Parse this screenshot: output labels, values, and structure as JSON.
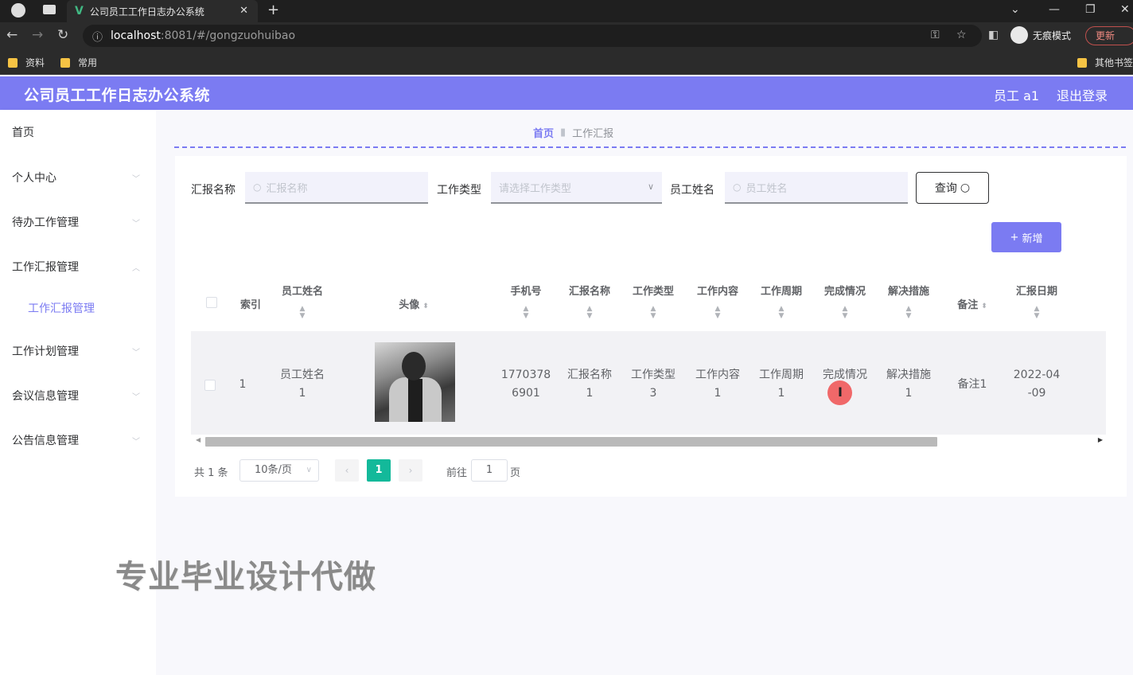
{
  "browser": {
    "tab_title": "公司员工工作日志办公系统",
    "url_host": "localhost",
    "url_path": ":8081/#/gongzuohuibao",
    "incognito_label": "无痕模式",
    "update_label": "更新",
    "bookmarks": [
      "资料",
      "常用"
    ],
    "other_bookmarks": "其他书签"
  },
  "header": {
    "title": "公司员工工作日志办公系统",
    "user": "员工 a1",
    "logout": "退出登录",
    "color": "#7b7bf2"
  },
  "sidebar": {
    "items": [
      {
        "label": "首页"
      },
      {
        "label": "个人中心"
      },
      {
        "label": "待办工作管理"
      },
      {
        "label": "工作汇报管理"
      },
      {
        "label": "工作计划管理"
      },
      {
        "label": "会议信息管理"
      },
      {
        "label": "公告信息管理"
      }
    ],
    "sub_item": "工作汇报管理"
  },
  "breadcrumb": {
    "home": "首页",
    "current": "工作汇报"
  },
  "filters": {
    "report_name_label": "汇报名称",
    "report_name_placeholder": "汇报名称",
    "work_type_label": "工作类型",
    "work_type_placeholder": "请选择工作类型",
    "employee_name_label": "员工姓名",
    "employee_name_placeholder": "员工姓名",
    "query_label": "查询",
    "add_label": "新增"
  },
  "table": {
    "headers": {
      "index": "索引",
      "name": "员工姓名",
      "avatar": "头像",
      "phone": "手机号",
      "report_name": "汇报名称",
      "work_type": "工作类型",
      "content": "工作内容",
      "period": "工作周期",
      "completion": "完成情况",
      "solution": "解决措施",
      "remark": "备注",
      "date": "汇报日期"
    },
    "rows": [
      {
        "index": "1",
        "name_1": "员工姓名",
        "name_2": "1",
        "phone_1": "1770378",
        "phone_2": "6901",
        "report_name_1": "汇报名称",
        "report_name_2": "1",
        "work_type_1": "工作类型",
        "work_type_2": "3",
        "content_1": "工作内容",
        "content_2": "1",
        "period_1": "工作周期",
        "period_2": "1",
        "completion": "完成情况",
        "solution_1": "解决措施",
        "solution_2": "1",
        "remark": "备注1",
        "date_1": "2022-04",
        "date_2": "-09"
      }
    ]
  },
  "pagination": {
    "total": "共 1 条",
    "page_size": "10条/页",
    "current_page": "1",
    "goto_label": "前往",
    "goto_value": "1",
    "page_suffix": "页"
  },
  "watermark": "专业毕业设计代做"
}
